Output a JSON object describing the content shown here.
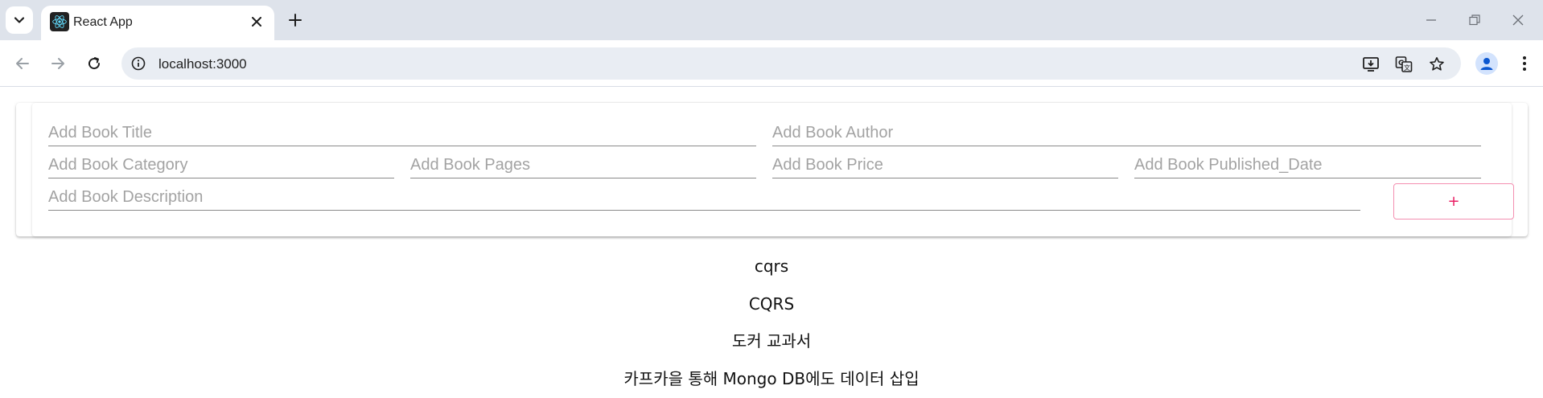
{
  "browser": {
    "tab_title": "React App",
    "url": "localhost:3000",
    "icons": {
      "tab_list": "chevron-down-icon",
      "favicon": "react-logo-icon",
      "close": "close-icon",
      "new_tab": "plus-icon",
      "back": "arrow-left-icon",
      "forward": "arrow-right-icon",
      "reload": "reload-icon",
      "site_info": "info-icon",
      "install": "install-app-icon",
      "translate": "translate-icon",
      "bookmark": "star-icon",
      "profile": "person-icon",
      "menu": "kebab-menu-icon"
    }
  },
  "form": {
    "title_placeholder": "Add Book Title",
    "author_placeholder": "Add Book Author",
    "category_placeholder": "Add Book Category",
    "pages_placeholder": "Add Book Pages",
    "price_placeholder": "Add Book Price",
    "published_date_placeholder": "Add Book Published_Date",
    "description_placeholder": "Add Book Description",
    "add_button_label": "+"
  },
  "books": [
    "cqrs",
    "CQRS",
    "도커 교과서",
    "카프카을 통해 Mongo DB에도 데이터 삽입"
  ],
  "colors": {
    "tabstrip_bg": "#dee3eb",
    "omnibox_bg": "#e9edf3",
    "accent_pink": "#e91e63"
  }
}
